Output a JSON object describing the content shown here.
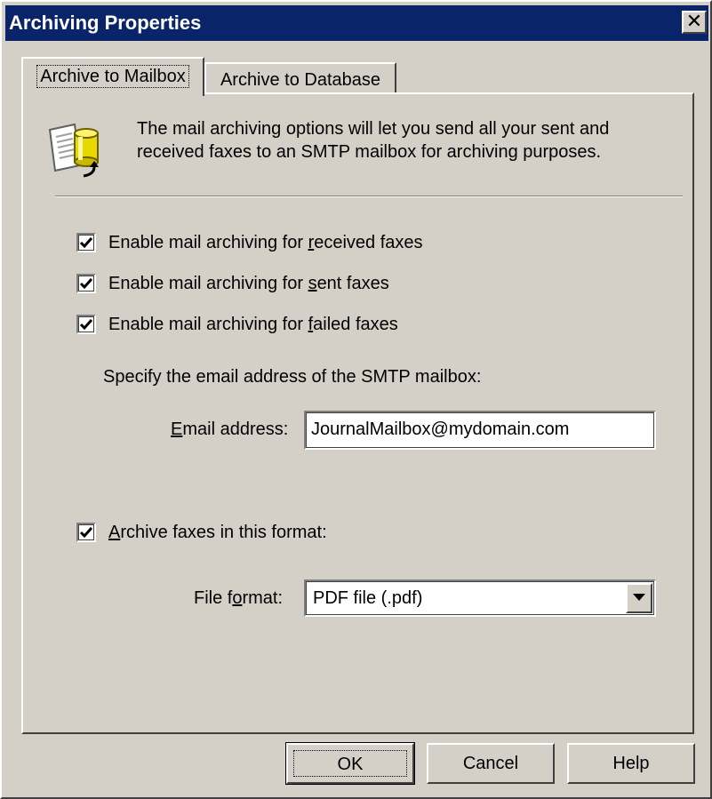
{
  "window": {
    "title": "Archiving Properties",
    "close_label": "✕"
  },
  "tabs": [
    {
      "label": "Archive to Mailbox",
      "selected": true
    },
    {
      "label": "Archive to Database",
      "selected": false
    }
  ],
  "panel": {
    "intro_line1": "The mail archiving options will let you send all your sent and",
    "intro_line2": "received faxes to an SMTP mailbox for archiving purposes.",
    "checkboxes": [
      {
        "prefix": "Enable mail archiving for ",
        "accel": "r",
        "suffix": "eceived faxes",
        "checked": true
      },
      {
        "prefix": "Enable mail archiving for ",
        "accel": "s",
        "suffix": "ent faxes",
        "checked": true
      },
      {
        "prefix": "Enable mail archiving for ",
        "accel": "f",
        "suffix": "ailed faxes",
        "checked": true
      }
    ],
    "specify_text": "Specify the email address of the SMTP mailbox:",
    "email": {
      "label_accel": "E",
      "label_rest": "mail address:",
      "value": "JournalMailbox@mydomain.com"
    },
    "archive_format": {
      "checked": true,
      "label_accel": "A",
      "label_rest": "rchive faxes in this format:"
    },
    "file_format": {
      "label_prefix": "File f",
      "label_accel": "o",
      "label_rest": "rmat:",
      "selected": "PDF file (.pdf)"
    }
  },
  "buttons": {
    "ok": "OK",
    "cancel": "Cancel",
    "help": "Help"
  },
  "colors": {
    "titlebar": "#0a246a",
    "face": "#d4d0c8"
  }
}
